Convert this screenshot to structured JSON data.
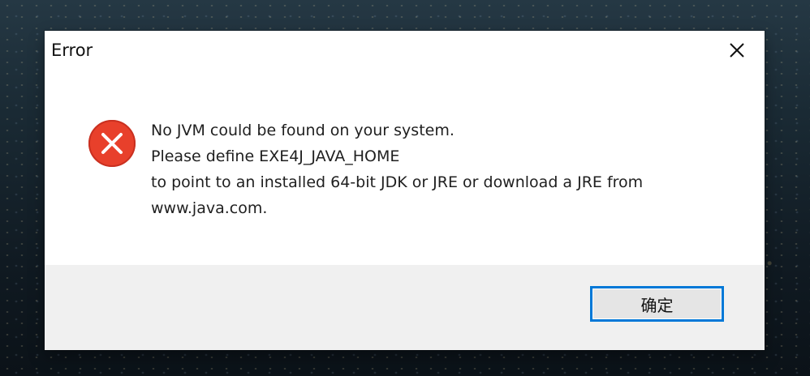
{
  "dialog": {
    "title": "Error",
    "close_icon": "close-icon",
    "error_icon": "error-icon",
    "message_lines": [
      "No JVM could be found on your system.",
      "Please define EXE4J_JAVA_HOME",
      "to point to an installed 64-bit JDK or JRE or download a JRE from",
      "www.java.com."
    ],
    "ok_label": "确定",
    "colors": {
      "error_red": "#e8402b",
      "focus_blue": "#0078d7",
      "footer_bg": "#f0f0f0"
    }
  }
}
